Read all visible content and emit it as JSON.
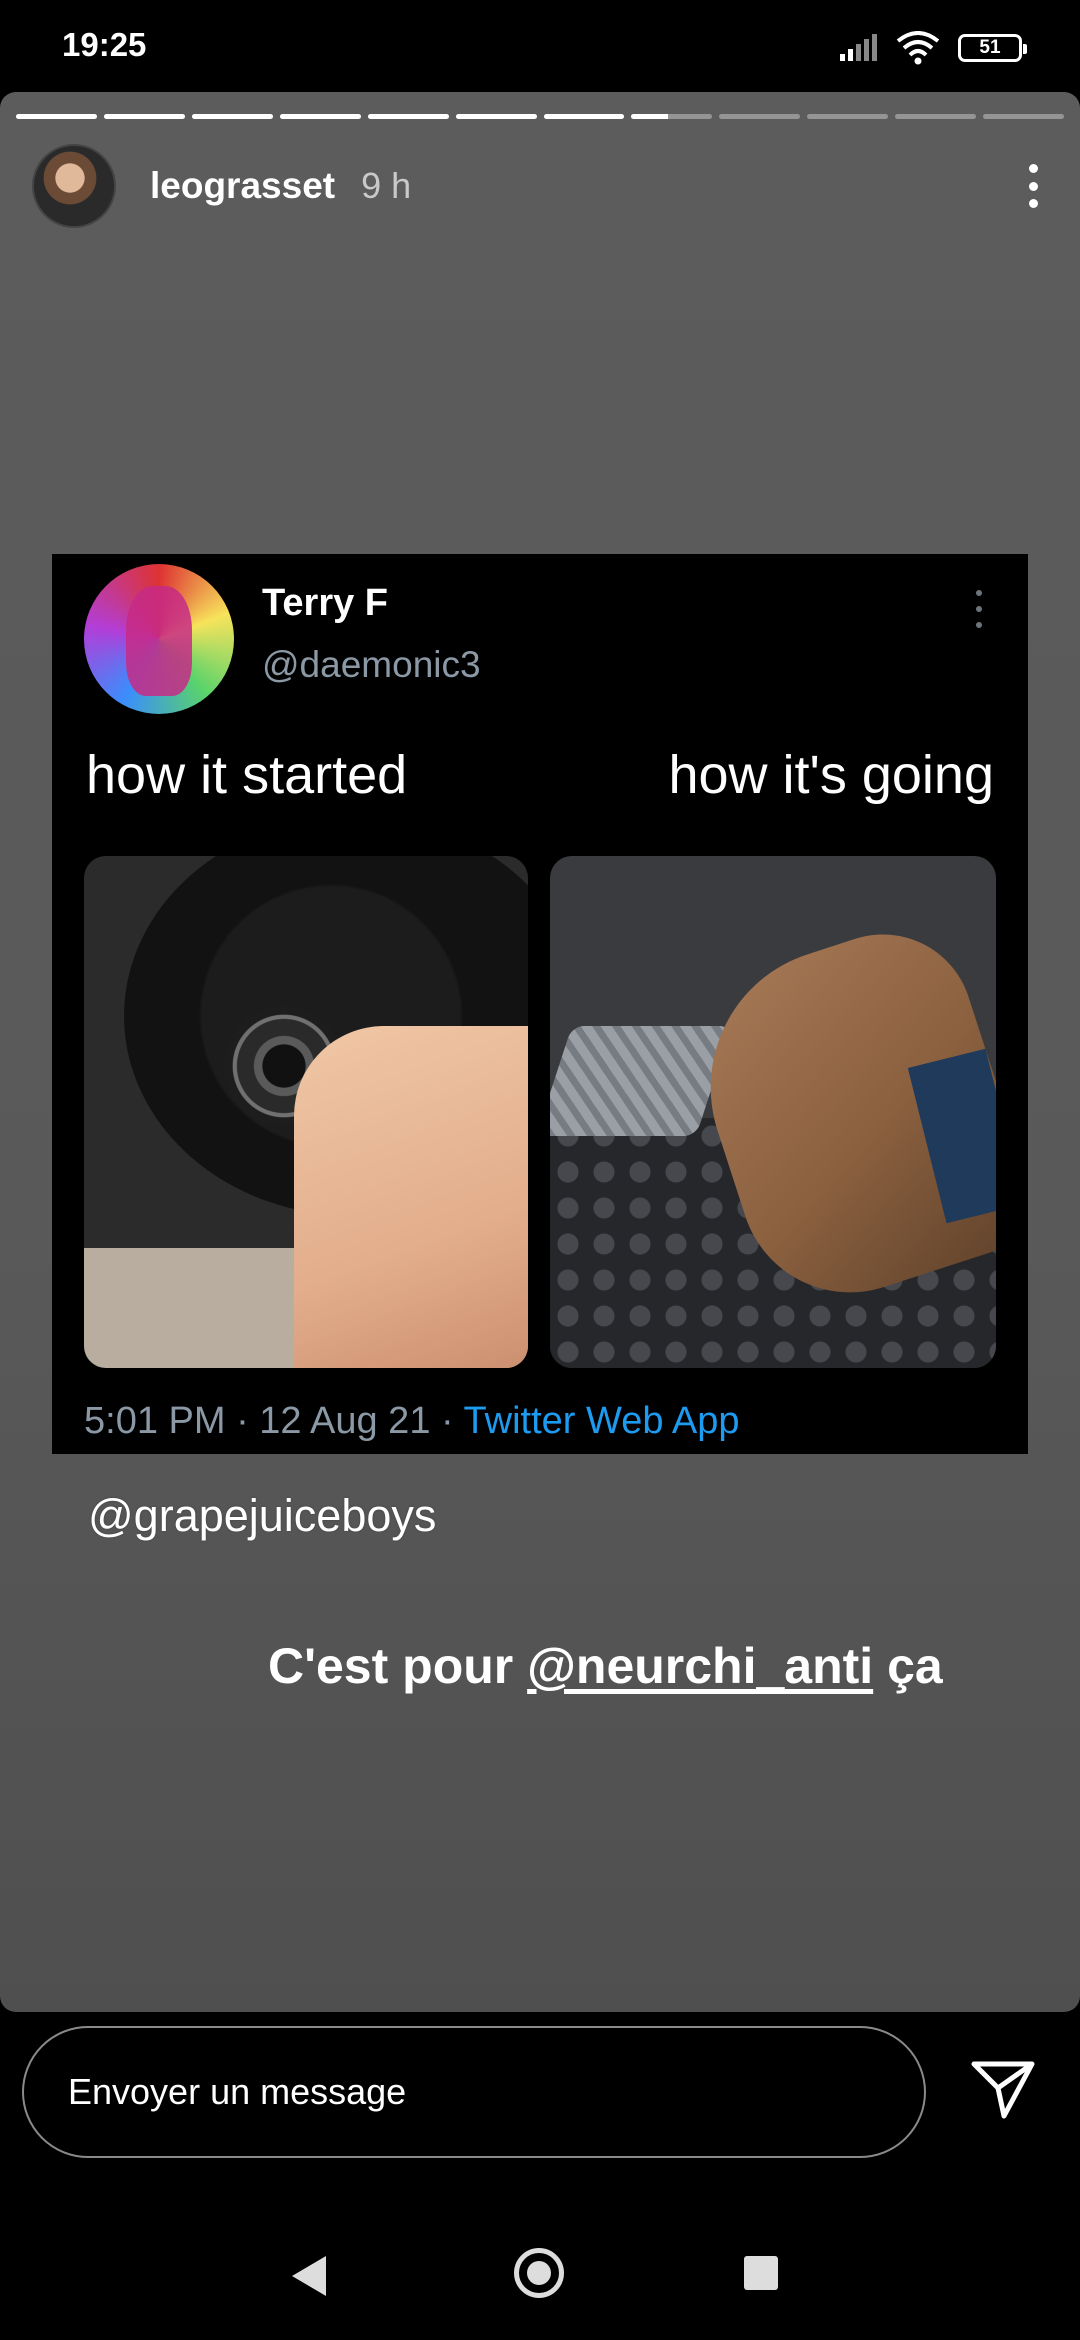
{
  "status_bar": {
    "time": "19:25",
    "battery": "51"
  },
  "story": {
    "progress": {
      "segments": 12,
      "current_index": 7,
      "current_fraction": 0.45
    },
    "user": {
      "username": "leograsset",
      "time_ago": "9 h"
    },
    "tweet": {
      "name": "Terry F",
      "handle": "@daemonic3",
      "caption_left": "how it started",
      "caption_right": "how it's going",
      "meta_time": "5:01 PM · 12 Aug 21 · ",
      "meta_source": "Twitter Web App"
    },
    "mention_1": "@grapejuiceboys",
    "mention_2_prefix": "C'est pour ",
    "mention_2_tag": "@neurchi_anti",
    "mention_2_suffix": " ça"
  },
  "reply": {
    "placeholder": "Envoyer un message"
  },
  "icons": {
    "signal": "signal-icon",
    "wifi": "wifi-icon",
    "battery": "battery-icon",
    "more": "more-vertical-icon",
    "send": "send-icon",
    "nav_back": "back-icon",
    "nav_home": "home-icon",
    "nav_recents": "recents-icon"
  }
}
